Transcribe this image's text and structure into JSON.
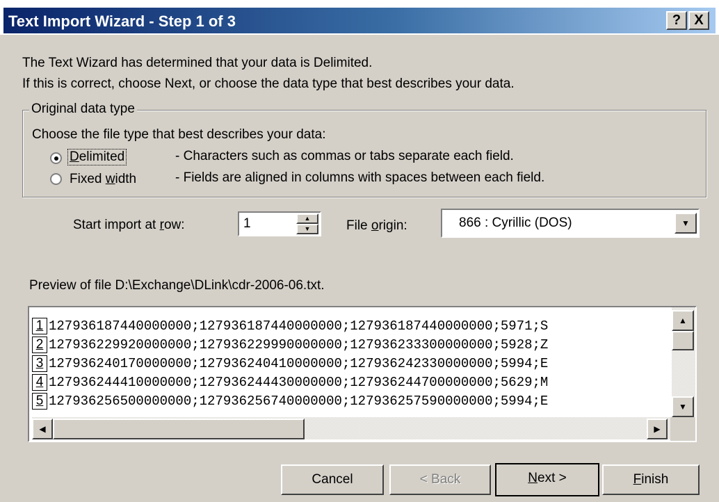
{
  "window": {
    "title": "Text Import Wizard - Step 1 of 3",
    "help_btn": "?",
    "close_btn": "X"
  },
  "intro": {
    "line1": "The Text Wizard has determined that your data is Delimited.",
    "line2": "If this is correct, choose Next, or choose the data type that best describes your data."
  },
  "group": {
    "legend": "Original data type",
    "prompt": "Choose the file type that best describes your data:",
    "options": [
      {
        "label_pre": "",
        "label_u": "D",
        "label_post": "elimited",
        "desc": "- Characters such as commas or tabs separate each field.",
        "selected": true
      },
      {
        "label_pre": "Fixed ",
        "label_u": "w",
        "label_post": "idth",
        "desc": "- Fields are aligned in columns with spaces between each field.",
        "selected": false
      }
    ]
  },
  "start_row": {
    "label_pre": "Start import at ",
    "label_u": "r",
    "label_post": "ow:",
    "value": "1"
  },
  "file_origin": {
    "label_pre": "File ",
    "label_u": "o",
    "label_post": "rigin:",
    "value": "866 : Cyrillic (DOS)"
  },
  "preview": {
    "label": "Preview of file D:\\Exchange\\DLink\\cdr-2006-06.txt.",
    "rows": [
      {
        "num": "1",
        "text": "127936187440000000;127936187440000000;127936187440000000;5971;S"
      },
      {
        "num": "2",
        "text": "127936229920000000;127936229990000000;127936233300000000;5928;Z"
      },
      {
        "num": "3",
        "text": "127936240170000000;127936240410000000;127936242330000000;5994;E"
      },
      {
        "num": "4",
        "text": "127936244410000000;127936244430000000;127936244700000000;5629;M"
      },
      {
        "num": "5",
        "text": "127936256500000000;127936256740000000;127936257590000000;5994;E"
      }
    ]
  },
  "buttons": {
    "cancel": "Cancel",
    "back": "< Back",
    "next_u": "N",
    "next_post": "ext >",
    "finish_u": "F",
    "finish_post": "inish"
  },
  "colors": {
    "face": "#d4d0c8",
    "title_start": "#0a246a",
    "title_end": "#a6caf0"
  },
  "icons": {
    "scroll_up": "up-arrow-icon",
    "scroll_down": "down-arrow-icon",
    "scroll_left": "left-arrow-icon",
    "scroll_right": "right-arrow-icon",
    "combo": "chevron-down-icon"
  }
}
